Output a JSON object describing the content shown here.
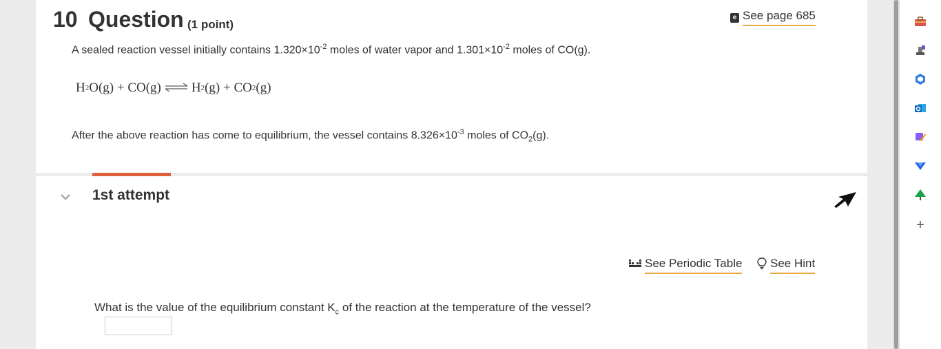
{
  "question": {
    "number": "10",
    "word": "Question",
    "points": "(1 point)",
    "see_page": "See page 685",
    "intro_a": "A sealed reaction vessel initially contains 1.320×10",
    "intro_exp1": "-2",
    "intro_b": " moles of water vapor and 1.301×10",
    "intro_exp2": "-2",
    "intro_c": " moles of CO(g).",
    "equation": {
      "r1": "H",
      "r1sub": "2",
      "r1b": "O(g) + CO(g)",
      "p1": "H",
      "p1sub": "2",
      "p1b": "(g) + CO",
      "p2sub": "2",
      "p2b": "(g)"
    },
    "after_a": "After the above reaction has come to equilibrium, the vessel contains 8.326×10",
    "after_exp": "-3",
    "after_b": " moles of CO",
    "after_sub": "2",
    "after_c": "(g)."
  },
  "attempt": {
    "label": "1st attempt",
    "periodic_table": "See Periodic Table",
    "hint": "See Hint",
    "prompt_a": "What is the value of the equilibrium constant K",
    "prompt_sub": "c",
    "prompt_b": " of the reaction at the temperature of the vessel?"
  },
  "sidebar": {
    "icons": [
      "toolbox-icon",
      "chess-icon",
      "copilot-icon",
      "outlook-icon",
      "designer-icon",
      "send-icon",
      "tree-icon",
      "plus-icon"
    ],
    "accent": "#e0603e",
    "link_underline": "#e8a93b"
  }
}
